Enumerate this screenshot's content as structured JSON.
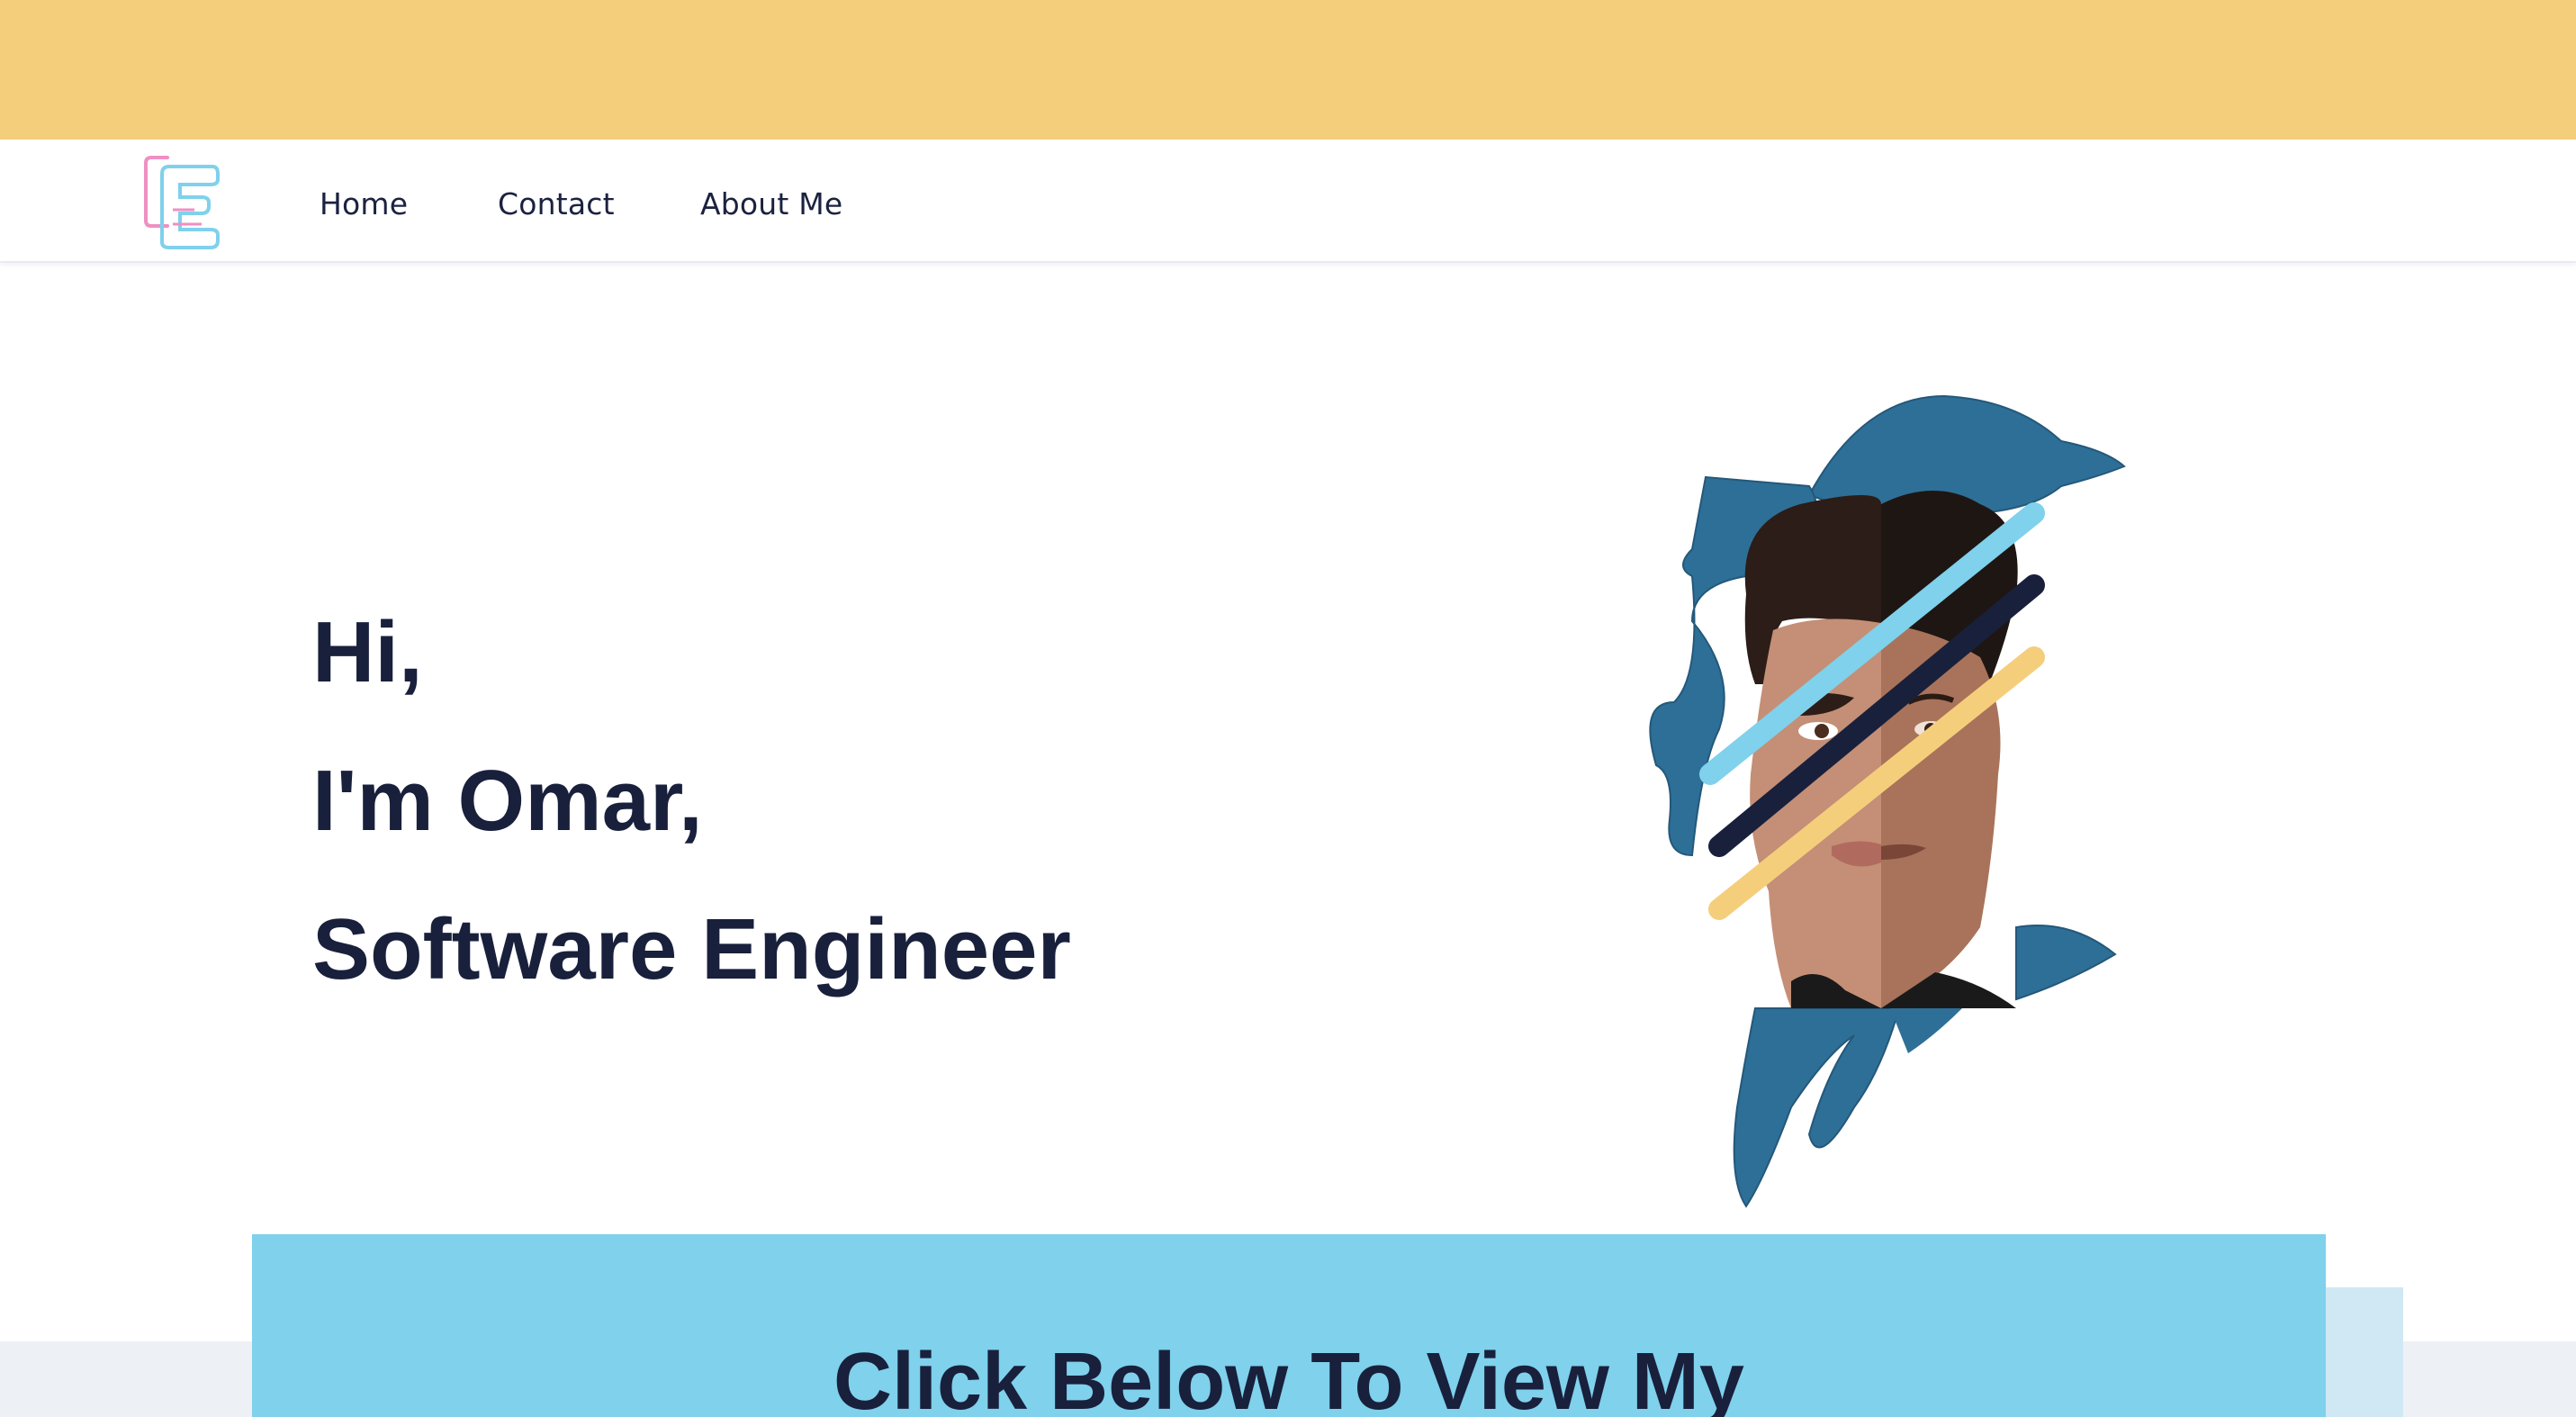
{
  "nav": {
    "links": [
      {
        "label": "Home"
      },
      {
        "label": "Contact"
      },
      {
        "label": "About Me"
      }
    ]
  },
  "hero": {
    "greeting": "Hi,",
    "name_line": "I'm Omar,",
    "role_line": "Software Engineer"
  },
  "cta": {
    "heading": "Click Below To View My"
  },
  "colors": {
    "top_band": "#f5ce7c",
    "text_dark": "#19203c",
    "cta_panel": "#7fd1ec",
    "shape_blue": "#2e6f97",
    "accent_light_blue": "#7fd1ec",
    "accent_yellow": "#f5ce7c"
  },
  "icons": {
    "logo": "logo-mark",
    "portrait": "portrait-illustration"
  }
}
